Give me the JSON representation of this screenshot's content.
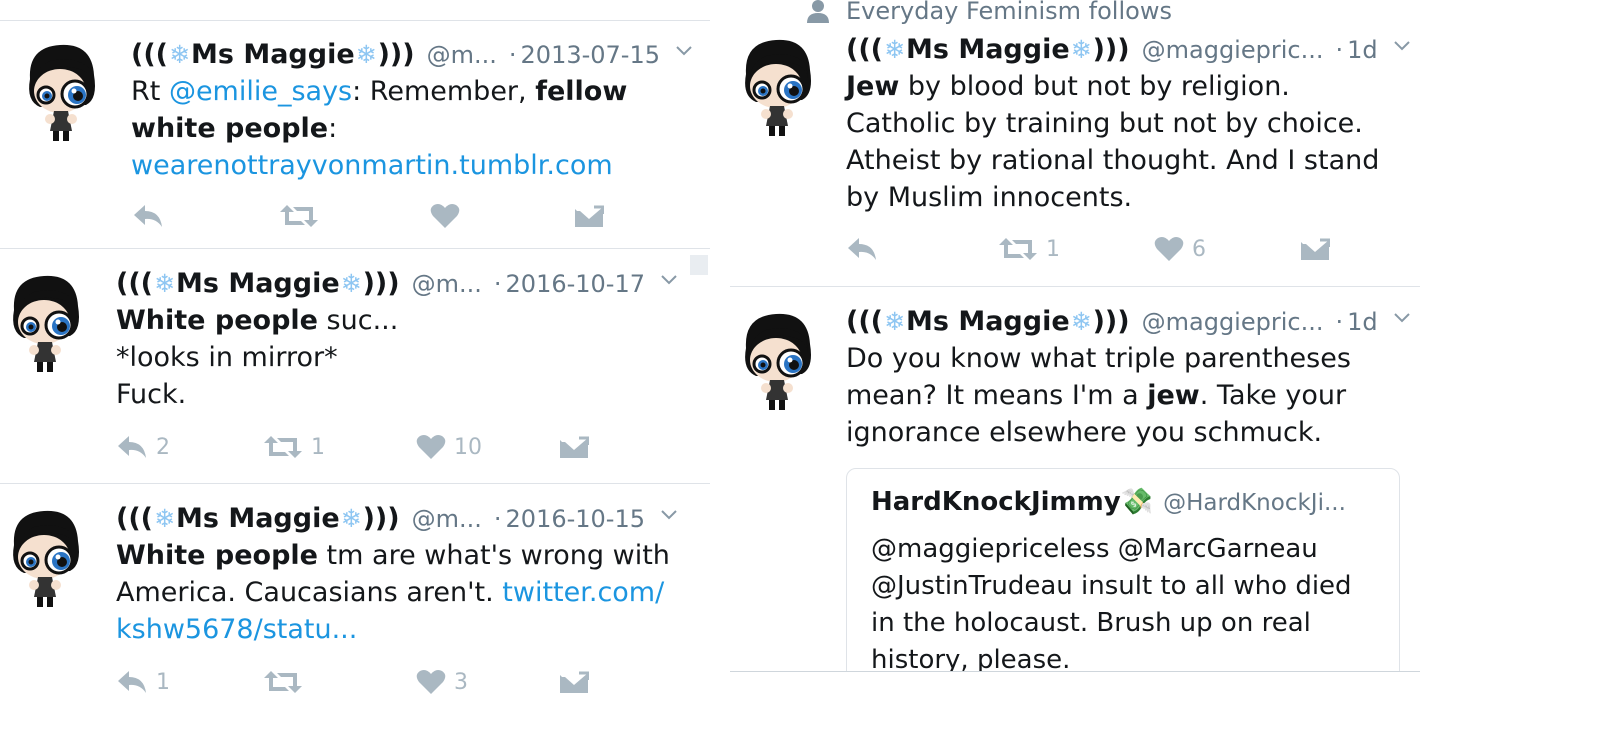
{
  "left": {
    "tweets": [
      {
        "name": "Ms Maggie",
        "prefix": "(((",
        "suffix": ")))",
        "handle": "@m...",
        "date": "2013-07-15",
        "text_parts": [
          "Rt ",
          "@emilie_says",
          ": Remember, ",
          "fellow\nwhite people",
          ":\n",
          "wearenottrayvonmartin.tumblr.com"
        ],
        "reply_count": "",
        "retweet_count": "",
        "like_count": ""
      },
      {
        "name": "Ms Maggie",
        "prefix": "(((",
        "suffix": ")))",
        "handle": "@m...",
        "date": "2016-10-17",
        "text_bold": "White people",
        "text_rest": " suc...\n*looks in mirror*\nFuck.",
        "reply_count": "2",
        "retweet_count": "1",
        "like_count": "10"
      },
      {
        "name": "Ms Maggie",
        "prefix": "(((",
        "suffix": ")))",
        "handle": "@m...",
        "date": "2016-10-15",
        "text_bold": "White people",
        "text_rest": " tm are what's wrong with\nAmerica.  Caucasians aren't. ",
        "text_link": "twitter.com/\nkshw5678/statu...",
        "reply_count": "1",
        "retweet_count": "",
        "like_count": "3"
      }
    ]
  },
  "right": {
    "social_context": "Everyday Feminism follows",
    "tweets": [
      {
        "name": "Ms Maggie",
        "prefix": "(((",
        "suffix": ")))",
        "handle": "@maggiepric...",
        "date": "1d",
        "text_bold": "Jew",
        "text_rest": " by blood but not by religion.\nCatholic by training but not by choice.\nAtheist by rational thought.  And I stand\nby Muslim innocents.",
        "reply_count": "",
        "retweet_count": "1",
        "like_count": "6"
      },
      {
        "name": "Ms Maggie",
        "prefix": "(((",
        "suffix": ")))",
        "handle": "@maggiepric...",
        "date": "1d",
        "text_pre": "Do you know what triple parentheses\nmean? It means I'm a ",
        "text_bold": "jew",
        "text_post": ".  Take your\nignorance elsewhere you schmuck.",
        "quote": {
          "name": "HardKnockJimmy",
          "emoji": "💸",
          "handle": "@HardKnockJi...",
          "text": "@maggiepriceless @MarcGarneau\n@JustinTrudeau insult to all who died\nin the holocaust. Brush up on real\nhistory, please."
        }
      }
    ]
  },
  "snowflake": "❄",
  "dot": "·",
  "colors": {
    "link": "#1b95e0",
    "muted": "#657786",
    "action": "#aab8c2",
    "divider": "#dfe3e8"
  }
}
